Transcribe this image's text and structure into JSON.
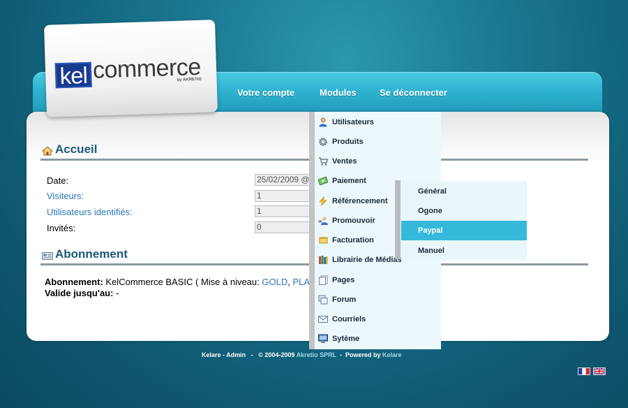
{
  "logo": {
    "part1": "kel",
    "part2": "commerce",
    "byline": "by AKRETIO"
  },
  "nav": {
    "items": [
      "Votre compte",
      "Modules",
      "Se déconnecter"
    ]
  },
  "home": {
    "title": "Accueil",
    "rows": [
      {
        "label": "Date:",
        "value": "25/02/2009 @"
      },
      {
        "label": "Visiteurs:",
        "value": "1"
      },
      {
        "label": "Utilisateurs identifiés:",
        "value": "1"
      },
      {
        "label": "Invités:",
        "value": "0"
      }
    ]
  },
  "subscription": {
    "title": "Abonnement",
    "line1_label": "Abonnement:",
    "line1_text": "KelCommerce BASIC ( Mise à niveau:",
    "upgrade_gold": "GOLD",
    "upgrade_sep": ",",
    "upgrade_pla": "PLA",
    "line2_label": "Valide jusqu'au:",
    "line2_value": "-"
  },
  "modules_menu": {
    "items": [
      {
        "label": "Utilisateurs",
        "icon": "user-icon"
      },
      {
        "label": "Produits",
        "icon": "gear-icon"
      },
      {
        "label": "Ventes",
        "icon": "cart-icon"
      },
      {
        "label": "Paiement",
        "icon": "money-icon"
      },
      {
        "label": "Référencement",
        "icon": "lightning-icon"
      },
      {
        "label": "Promouvoir",
        "icon": "promote-icon"
      },
      {
        "label": "Facturation",
        "icon": "invoice-icon"
      },
      {
        "label": "Librairie de Médias",
        "icon": "media-library-icon"
      },
      {
        "label": "Pages",
        "icon": "pages-icon"
      },
      {
        "label": "Forum",
        "icon": "forum-icon"
      },
      {
        "label": "Courriels",
        "icon": "mail-icon"
      },
      {
        "label": "Sytème",
        "icon": "system-icon"
      }
    ]
  },
  "payment_submenu": {
    "items": [
      "Général",
      "Ogone",
      "Paypal",
      "Manuel"
    ],
    "active": "Paypal"
  },
  "footer": {
    "user": "Kelare - Admin",
    "sep": "-",
    "copyright": "© 2004-2009",
    "company": "Akretio SPRL",
    "sep2": "-",
    "powered": "Powered by",
    "brand": "Kelare"
  },
  "languages": [
    "french-flag-icon",
    "uk-flag-icon"
  ],
  "colors": {
    "accent": "#35b9da",
    "title": "#1c5a79",
    "link": "#2a78b8"
  }
}
